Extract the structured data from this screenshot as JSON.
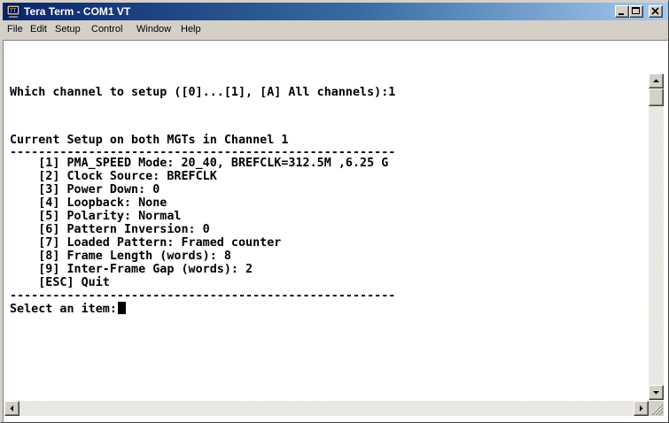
{
  "window": {
    "title": "Tera Term - COM1 VT",
    "icon": "teraterm-icon"
  },
  "menu": [
    "File",
    "Edit",
    "Setup",
    "Control",
    "Window",
    "Help"
  ],
  "terminal": {
    "prompt_line": "Which channel to setup ([0]...[1], [A] All channels):1",
    "setup_header": "Current Setup on both MGTs in Channel 1",
    "separator": "------------------------------------------------------",
    "items": [
      "    [1] PMA_SPEED Mode: 20_40, BREFCLK=312.5M ,6.25 G",
      "    [2] Clock Source: BREFCLK",
      "    [3] Power Down: 0",
      "    [4] Loopback: None",
      "    [5] Polarity: Normal",
      "    [6] Pattern Inversion: 0",
      "    [7] Loaded Pattern: Framed counter",
      "    [8] Frame Length (words): 8",
      "    [9] Inter-Frame Gap (words): 2",
      "    [ESC] Quit"
    ],
    "select_prompt": "Select an item:"
  },
  "colors": {
    "titlebar_start": "#0a246a",
    "titlebar_end": "#a6caf0",
    "chrome": "#d4d0c8",
    "terminal_bg": "#ffffff",
    "terminal_fg": "#000000"
  }
}
